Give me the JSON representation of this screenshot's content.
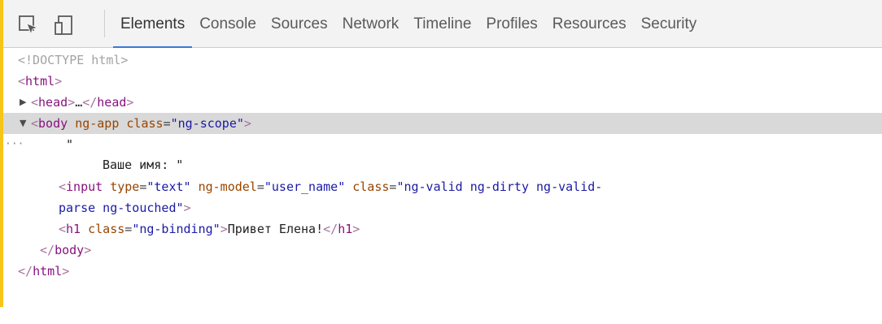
{
  "toolbar": {
    "inspect_icon": "inspect-element-icon",
    "device_icon": "device-mode-icon",
    "tabs": [
      "Elements",
      "Console",
      "Sources",
      "Network",
      "Timeline",
      "Profiles",
      "Resources",
      "Security"
    ],
    "active_tab": "Elements",
    "accent_color": "#3879d9"
  },
  "dom": {
    "doctype": "<!DOCTYPE html>",
    "html_open": "html",
    "head_tag": "head",
    "head_ellipsis": "…",
    "body_tag": "body",
    "body_attr1": "ng-app",
    "body_attr2_name": "class",
    "body_attr2_value": "ng-scope",
    "text_quote_open": "\"",
    "text_content": "Ваше имя: \"",
    "input_tag": "input",
    "input_type_name": "type",
    "input_type_value": "text",
    "input_model_name": "ng-model",
    "input_model_value": "user_name",
    "input_class_name": "class",
    "input_class_value_part1": "ng-valid ng-dirty ng-valid-",
    "input_class_value_part2": "parse ng-touched",
    "h1_tag": "h1",
    "h1_class_name": "class",
    "h1_class_value": "ng-binding",
    "h1_text": "Привет Елена!",
    "body_close": "body",
    "html_close": "html",
    "selected_row_dots": "···"
  },
  "colors": {
    "tag": "#881280",
    "attribute": "#994500",
    "value": "#1a1aa6",
    "selected_row": "#d9d9d9",
    "left_accent": "#f5c518"
  }
}
